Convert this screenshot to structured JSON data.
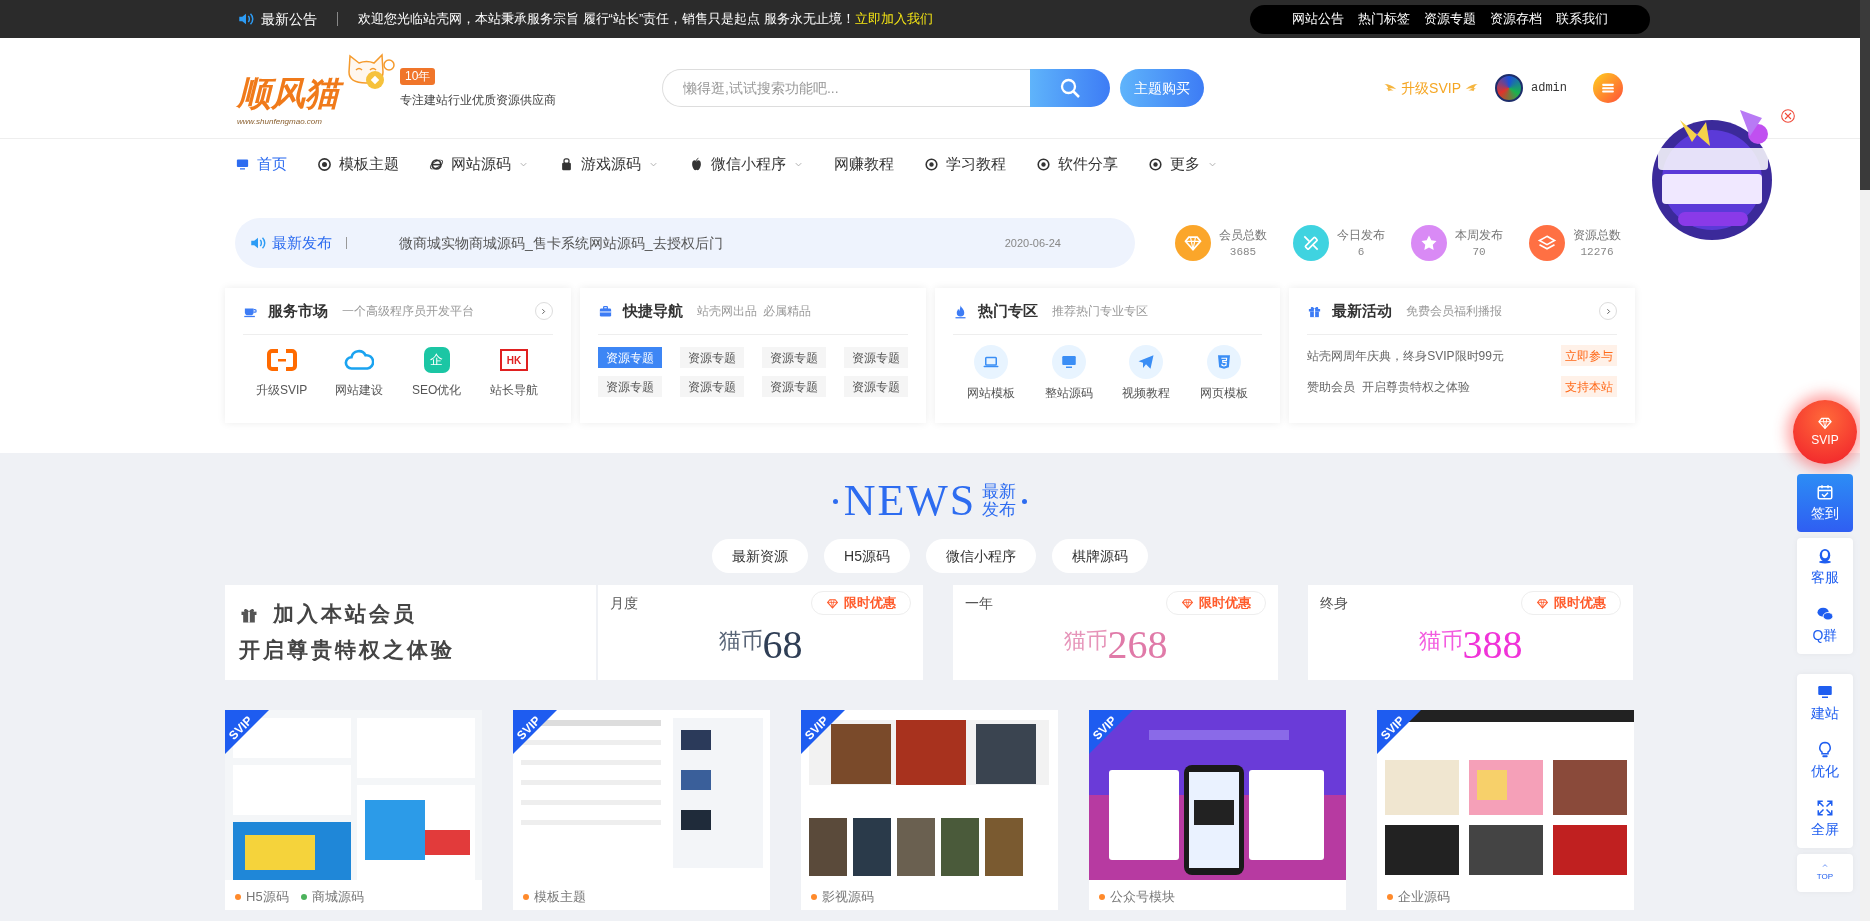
{
  "top_bar": {
    "title": "最新公告",
    "message": "欢迎您光临站壳网，本站秉承服务宗旨 履行“站长”责任，销售只是起点 服务永无止境！",
    "link": "立即加入我们",
    "links": [
      "网站公告",
      "热门标签",
      "资源专题",
      "资源存档",
      "联系我们"
    ]
  },
  "header": {
    "logo_text": "顺风猫",
    "logo_url": "www.shunfengmao.com",
    "badge": "10年",
    "tagline": "专注建站行业优质资源供应商",
    "search": {
      "placeholder": "懒得逛,试试搜索功能吧..."
    },
    "buy_button": "主题购买",
    "upgrade": "升级SVIP",
    "user": "admin"
  },
  "nav": [
    {
      "label": "首页",
      "menu": false,
      "selected": true
    },
    {
      "label": "模板主题",
      "menu": false,
      "selected": false
    },
    {
      "label": "网站源码",
      "menu": true,
      "selected": false
    },
    {
      "label": "游戏源码",
      "menu": true,
      "selected": false
    },
    {
      "label": "微信小程序",
      "menu": true,
      "selected": false
    },
    {
      "label": "网赚教程",
      "menu": false,
      "selected": false
    },
    {
      "label": "学习教程",
      "menu": false,
      "selected": false
    },
    {
      "label": "软件分享",
      "menu": false,
      "selected": false
    },
    {
      "label": "更多",
      "menu": true,
      "selected": false
    }
  ],
  "latest": {
    "label": "最新发布",
    "title": "微商城实物商城源码_售卡系统网站源码_去授权后门",
    "date": "2020-06-24"
  },
  "stats": [
    {
      "label": "会员总数",
      "value": "3685",
      "color": "#fba62a"
    },
    {
      "label": "今日发布",
      "value": "6",
      "color": "#3fd3e0"
    },
    {
      "label": "本周发布",
      "value": "70",
      "color": "#d98af5"
    },
    {
      "label": "资源总数",
      "value": "12276",
      "color": "#ff7043"
    }
  ],
  "service_market": {
    "title": "服务市场",
    "subtitle": "一个高级程序员开发平台",
    "items": [
      {
        "label": "升级SVIP"
      },
      {
        "label": "网站建设"
      },
      {
        "label": "SEO优化",
        "glyph": "企"
      },
      {
        "label": "站长导航",
        "glyph": "HK"
      }
    ]
  },
  "quick_nav": {
    "title": "快捷导航",
    "subtitle": "站壳网出品  必属精品",
    "tags": [
      {
        "label": "资源专题",
        "selected": true
      },
      {
        "label": "资源专题",
        "selected": false
      },
      {
        "label": "资源专题",
        "selected": false
      },
      {
        "label": "资源专题",
        "selected": false
      },
      {
        "label": "资源专题",
        "selected": false
      },
      {
        "label": "资源专题",
        "selected": false
      },
      {
        "label": "资源专题",
        "selected": false
      },
      {
        "label": "资源专题",
        "selected": false
      }
    ]
  },
  "hot_zone": {
    "title": "热门专区",
    "subtitle": "推荐热门专业专区",
    "items": [
      {
        "label": "网站模板"
      },
      {
        "label": "整站源码"
      },
      {
        "label": "视频教程"
      },
      {
        "label": "网页模板"
      }
    ]
  },
  "activities": {
    "title": "最新活动",
    "subtitle": "免费会员福利播报",
    "rows": [
      {
        "text": "站壳网周年庆典，终身SVIP限时99元",
        "action": "立即参与"
      },
      {
        "text": "赞助会员  开启尊贵特权之体验",
        "action": "支持本站"
      }
    ]
  },
  "news": {
    "title": "NEWS",
    "subtitle_1": "最新",
    "subtitle_2": "发布",
    "tabs": [
      "最新资源",
      "H5源码",
      "微信小程序",
      "棋牌源码"
    ]
  },
  "membership": {
    "line_1": "加入本站会员",
    "line_2": "开启尊贵特权之体验",
    "plans": [
      {
        "name": "月度",
        "badge": "限时优惠",
        "currency": "猫币",
        "price": "68",
        "color": "#2f3e55"
      },
      {
        "name": "一年",
        "badge": "限时优惠",
        "currency": "猫币",
        "price": "268",
        "color": "#e07aa8"
      },
      {
        "name": "终身",
        "badge": "限时优惠",
        "currency": "猫币",
        "price": "388",
        "color": "#f033d8"
      }
    ]
  },
  "products": [
    {
      "badge": "SVIP",
      "tags": [
        {
          "label": "H5源码",
          "color": "#ff8a2b"
        },
        {
          "label": "商城源码",
          "color": "#4cb25c"
        }
      ]
    },
    {
      "badge": "SVIP",
      "tags": [
        {
          "label": "模板主题",
          "color": "#ff8a2b"
        }
      ]
    },
    {
      "badge": "SVIP",
      "tags": [
        {
          "label": "影视源码",
          "color": "#ff8a2b"
        }
      ]
    },
    {
      "badge": "SVIP",
      "tags": [
        {
          "label": "公众号模块",
          "color": "#ff8a2b"
        }
      ]
    },
    {
      "badge": "SVIP",
      "tags": [
        {
          "label": "企业源码",
          "color": "#ff8a2b"
        }
      ]
    }
  ],
  "side_tools": {
    "svip": "SVIP",
    "groups": [
      {
        "highlighted": true,
        "items": [
          "签到"
        ]
      },
      {
        "highlighted": false,
        "items": [
          "客服",
          "Q群"
        ]
      },
      {
        "highlighted": false,
        "items": [
          "建站",
          "优化",
          "全屏"
        ]
      },
      {
        "highlighted": false,
        "items": [
          "TOP"
        ]
      }
    ]
  }
}
